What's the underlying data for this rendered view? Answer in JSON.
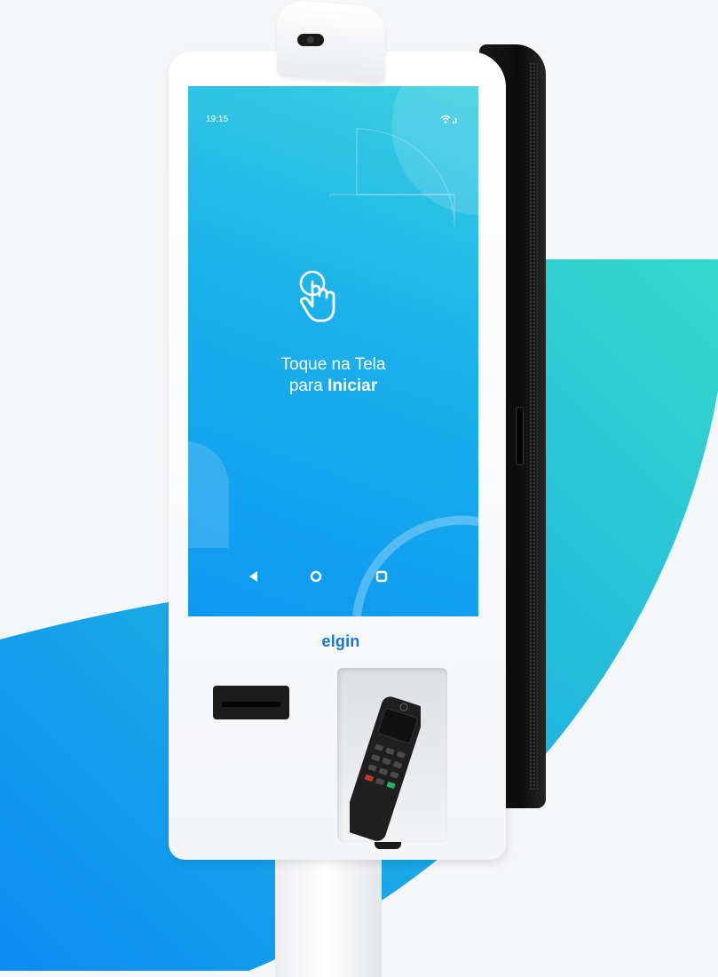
{
  "screen": {
    "status_time": "19:15",
    "status_icons": [
      "wifi-icon",
      "signal-icon"
    ],
    "touch_icon": "tap-hand-icon",
    "prompt_line1": "Toque na Tela",
    "prompt_line2_prefix": "para ",
    "prompt_line2_bold": "Iniciar",
    "nav": [
      {
        "name": "back",
        "icon": "triangle-back-icon"
      },
      {
        "name": "home",
        "icon": "circle-home-icon"
      },
      {
        "name": "recents",
        "icon": "square-recents-icon"
      }
    ]
  },
  "kiosk": {
    "brand": "elgin"
  },
  "colors": {
    "screen_top": "#39cfe0",
    "screen_bottom": "#0d98f2",
    "brand": "#1378d8",
    "bg_gradient_start": "#0a8cf5",
    "bg_gradient_end": "#35d8cc"
  }
}
